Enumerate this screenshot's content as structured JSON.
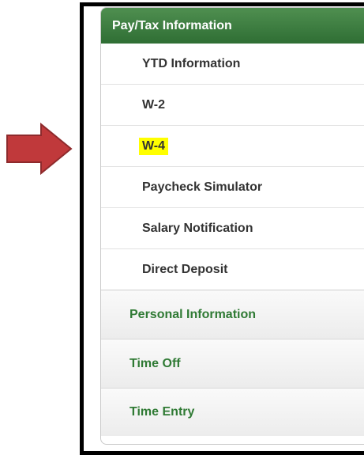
{
  "menu": {
    "header_label": "Pay/Tax Information",
    "sub_items": [
      {
        "label": "YTD Information"
      },
      {
        "label": "W-2"
      },
      {
        "label": "W-4",
        "highlighted": true
      },
      {
        "label": "Paycheck Simulator"
      },
      {
        "label": "Salary Notification"
      },
      {
        "label": "Direct Deposit"
      }
    ],
    "sections": [
      {
        "label": "Personal Information"
      },
      {
        "label": "Time Off"
      },
      {
        "label": "Time Entry"
      }
    ]
  },
  "colors": {
    "header_bg": "#3a7b3e",
    "section_text": "#2f7a34",
    "highlight": "#ffff00",
    "arrow": "#c0393b"
  }
}
